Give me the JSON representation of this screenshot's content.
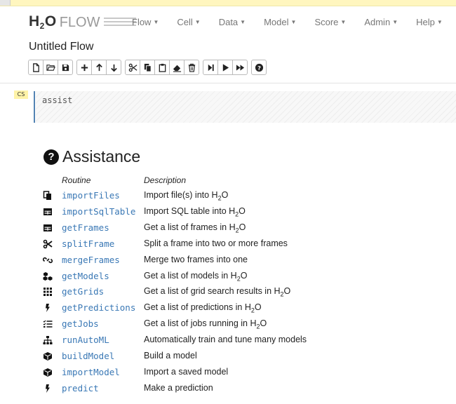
{
  "app": {
    "logo_main": "H",
    "logo_sub": "2",
    "logo_o": "O",
    "logo_flow": "FLOW"
  },
  "nav": [
    {
      "label": "Flow"
    },
    {
      "label": "Cell"
    },
    {
      "label": "Data"
    },
    {
      "label": "Model"
    },
    {
      "label": "Score"
    },
    {
      "label": "Admin"
    },
    {
      "label": "Help"
    }
  ],
  "flow_title": "Untitled Flow",
  "toolbar": {
    "groups": [
      [
        "new-file-icon",
        "open-folder-icon",
        "save-icon"
      ],
      [
        "plus-icon",
        "arrow-up-icon",
        "arrow-down-icon"
      ],
      [
        "scissors-icon",
        "copy-icon",
        "clipboard-icon",
        "eraser-icon",
        "trash-icon"
      ],
      [
        "step-forward-icon",
        "play-icon",
        "fast-forward-icon"
      ],
      [
        "help-icon"
      ]
    ]
  },
  "cell": {
    "type_tag": "CS",
    "code": "assist"
  },
  "assistance": {
    "title": "Assistance",
    "col_routine": "Routine",
    "col_description": "Description",
    "rows": [
      {
        "icon": "copy-icon",
        "routine": "importFiles",
        "pre": "Import file(s) into H",
        "sub": "2",
        "post": "O"
      },
      {
        "icon": "table-icon",
        "routine": "importSqlTable",
        "pre": "Import SQL table into H",
        "sub": "2",
        "post": "O"
      },
      {
        "icon": "table-icon",
        "routine": "getFrames",
        "pre": "Get a list of frames in H",
        "sub": "2",
        "post": "O"
      },
      {
        "icon": "scissors-icon",
        "routine": "splitFrame",
        "pre": "Split a frame into two or more frames",
        "sub": "",
        "post": ""
      },
      {
        "icon": "link-icon",
        "routine": "mergeFrames",
        "pre": "Merge two frames into one",
        "sub": "",
        "post": ""
      },
      {
        "icon": "cubes-icon",
        "routine": "getModels",
        "pre": "Get a list of models in H",
        "sub": "2",
        "post": "O"
      },
      {
        "icon": "grid-icon",
        "routine": "getGrids",
        "pre": "Get a list of grid search results in H",
        "sub": "2",
        "post": "O"
      },
      {
        "icon": "bolt-icon",
        "routine": "getPredictions",
        "pre": "Get a list of predictions in H",
        "sub": "2",
        "post": "O"
      },
      {
        "icon": "tasks-icon",
        "routine": "getJobs",
        "pre": "Get a list of jobs running in H",
        "sub": "2",
        "post": "O"
      },
      {
        "icon": "sitemap-icon",
        "routine": "runAutoML",
        "pre": "Automatically train and tune many models",
        "sub": "",
        "post": ""
      },
      {
        "icon": "cube-icon",
        "routine": "buildModel",
        "pre": "Build a model",
        "sub": "",
        "post": ""
      },
      {
        "icon": "cube-icon",
        "routine": "importModel",
        "pre": "Import a saved model",
        "sub": "",
        "post": ""
      },
      {
        "icon": "bolt-icon",
        "routine": "predict",
        "pre": "Make a prediction",
        "sub": "",
        "post": ""
      }
    ]
  }
}
